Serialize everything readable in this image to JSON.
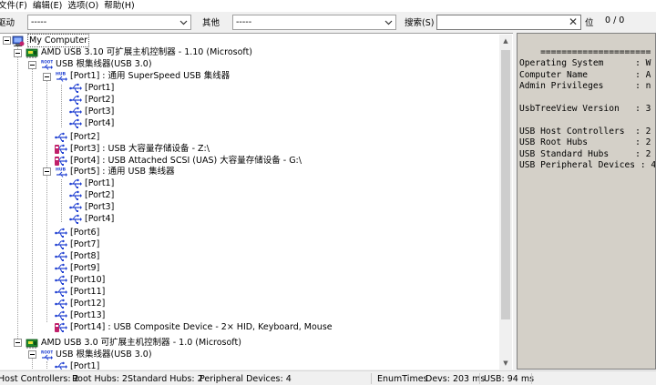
{
  "menu": [
    "文件(F)",
    "编辑(E)",
    "选项(O)",
    "帮助(H)"
  ],
  "toolbar": {
    "driver_label": "驱动",
    "driver_value": "-----",
    "other_label": "其他",
    "other_value": "-----",
    "search_label": "搜索(S)",
    "search_value": "",
    "position_label": "位",
    "count": "0 / 0"
  },
  "tree": {
    "root": "My Computer",
    "ctrl1": "AMD USB 3.10 可扩展主机控制器 - 1.10 (Microsoft)",
    "hub1": "USB 根集线器(USB 3.0)",
    "port1": "[Port1] : 通用 SuperSpeed USB 集线器",
    "p1_1": "[Port1]",
    "p1_2": "[Port2]",
    "p1_3": "[Port3]",
    "p1_4": "[Port4]",
    "port2": "[Port2]",
    "port3": "[Port3] : USB 大容量存储设备 - Z:\\",
    "port4": "[Port4] : USB Attached SCSI (UAS) 大容量存储设备 - G:\\",
    "port5": "[Port5] : 通用 USB 集线器",
    "p5_1": "[Port1]",
    "p5_2": "[Port2]",
    "p5_3": "[Port3]",
    "p5_4": "[Port4]",
    "port6": "[Port6]",
    "port7": "[Port7]",
    "port8": "[Port8]",
    "port9": "[Port9]",
    "port10": "[Port10]",
    "port11": "[Port11]",
    "port12": "[Port12]",
    "port13": "[Port13]",
    "port14": "[Port14] : USB Composite Device - 2× HID, Keyboard, Mouse",
    "ctrl2": "AMD USB 3.0 可扩展主机控制器 - 1.0 (Microsoft)",
    "hub2": "USB 根集线器(USB 3.0)",
    "h2_port1": "[Port1]",
    "hub_badge": "HUB",
    "root_badge": "ROOT"
  },
  "info": {
    "text": "    =====================\nOperating System      : W\nComputer Name         : A\nAdmin Privileges      : n\n\nUsbTreeView Version   : 3\n\nUSB Host Controllers  : 2\nUSB Root Hubs         : 2\nUSB Standard Hubs     : 2\nUSB Peripheral Devices : 4"
  },
  "status": {
    "host_controllers": "Host Controllers: 2",
    "root_hubs": "Root Hubs: 2",
    "standard_hubs": "Standard Hubs: 2",
    "peripheral_devices": "Peripheral Devices: 4",
    "enum_times": "EnumTimes",
    "devs": "Devs: 203 ms",
    "usb": "USB: 94 ms"
  },
  "colors": {
    "usb_blue": "#1f3fd1",
    "device_pink": "#c0206a",
    "controller_green": "#1e8a2c",
    "info_bg": "#d4d0c8"
  }
}
